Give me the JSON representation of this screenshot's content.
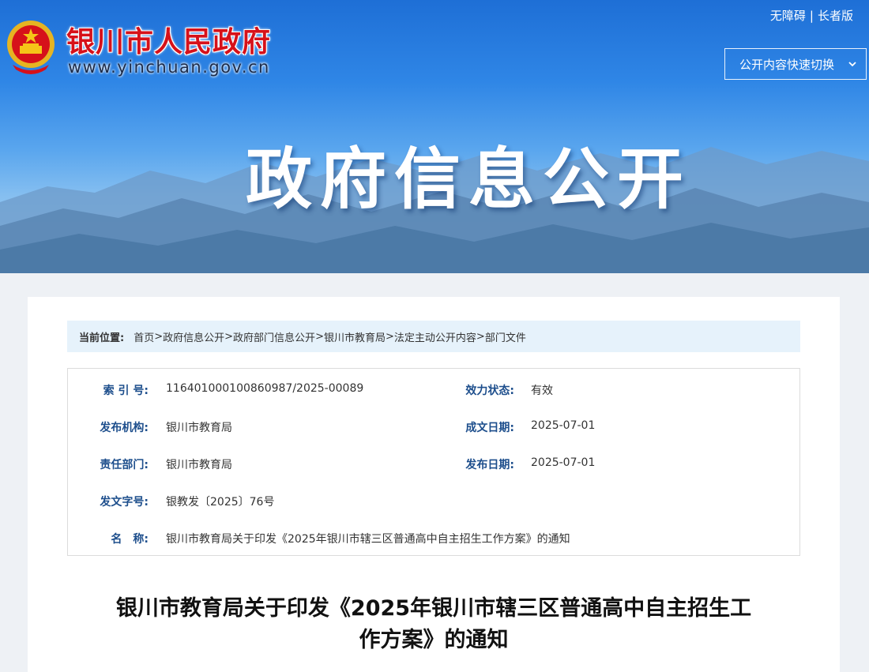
{
  "header": {
    "site_name": "银川市人民政府",
    "site_url": "www.yinchuan.gov.cn",
    "links": [
      "无障碍",
      "长者版"
    ],
    "link_separator": "|",
    "switch_label": "公开内容快速切换",
    "banner_title": "政府信息公开"
  },
  "breadcrumb": {
    "label": "当前位置:",
    "items": [
      "首页",
      "政府信息公开",
      "政府部门信息公开",
      "银川市教育局",
      "法定主动公开内容",
      "部门文件"
    ],
    "separator": ">"
  },
  "meta": {
    "index_no_label": "索 引 号:",
    "index_no": "116401000100860987/2025-00089",
    "status_label": "效力状态:",
    "status": "有效",
    "publisher_label": "发布机构:",
    "publisher": "银川市教育局",
    "created_label": "成文日期:",
    "created": "2025-07-01",
    "dept_label": "责任部门:",
    "dept": "银川市教育局",
    "published_label": "发布日期:",
    "published": "2025-07-01",
    "doc_no_label": "发文字号:",
    "doc_no": "银教发〔2025〕76号",
    "name_label": "名　称:",
    "name": "银川市教育局关于印发《2025年银川市辖三区普通高中自主招生工作方案》的通知"
  },
  "document": {
    "title_line1": "银川市教育局关于印发《2025年银川市辖三区普通高中自主招生工",
    "title_line2": "作方案》的通知"
  },
  "colors": {
    "brand_red": "#d6111a",
    "label_blue": "#1d4e8c",
    "breadcrumb_bg": "#e6f2fb"
  }
}
